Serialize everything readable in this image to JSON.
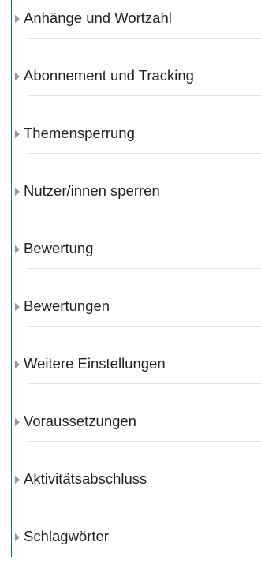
{
  "colors": {
    "accent_rule": "#0f6b76",
    "text": "#1d2125",
    "caret": "#8f959e",
    "divider": "#dee2e6"
  },
  "sections": [
    {
      "label": "Anhänge und Wortzahl",
      "icon": "caret-right-icon"
    },
    {
      "label": "Abonnement und Tracking",
      "icon": "caret-right-icon"
    },
    {
      "label": "Themensperrung",
      "icon": "caret-right-icon"
    },
    {
      "label": "Nutzer/innen sperren",
      "icon": "caret-right-icon"
    },
    {
      "label": "Bewertung",
      "icon": "caret-right-icon"
    },
    {
      "label": "Bewertungen",
      "icon": "caret-right-icon"
    },
    {
      "label": "Weitere Einstellungen",
      "icon": "caret-right-icon"
    },
    {
      "label": "Voraussetzungen",
      "icon": "caret-right-icon"
    },
    {
      "label": "Aktivitätsabschluss",
      "icon": "caret-right-icon"
    },
    {
      "label": "Schlagwörter",
      "icon": "caret-right-icon"
    }
  ]
}
